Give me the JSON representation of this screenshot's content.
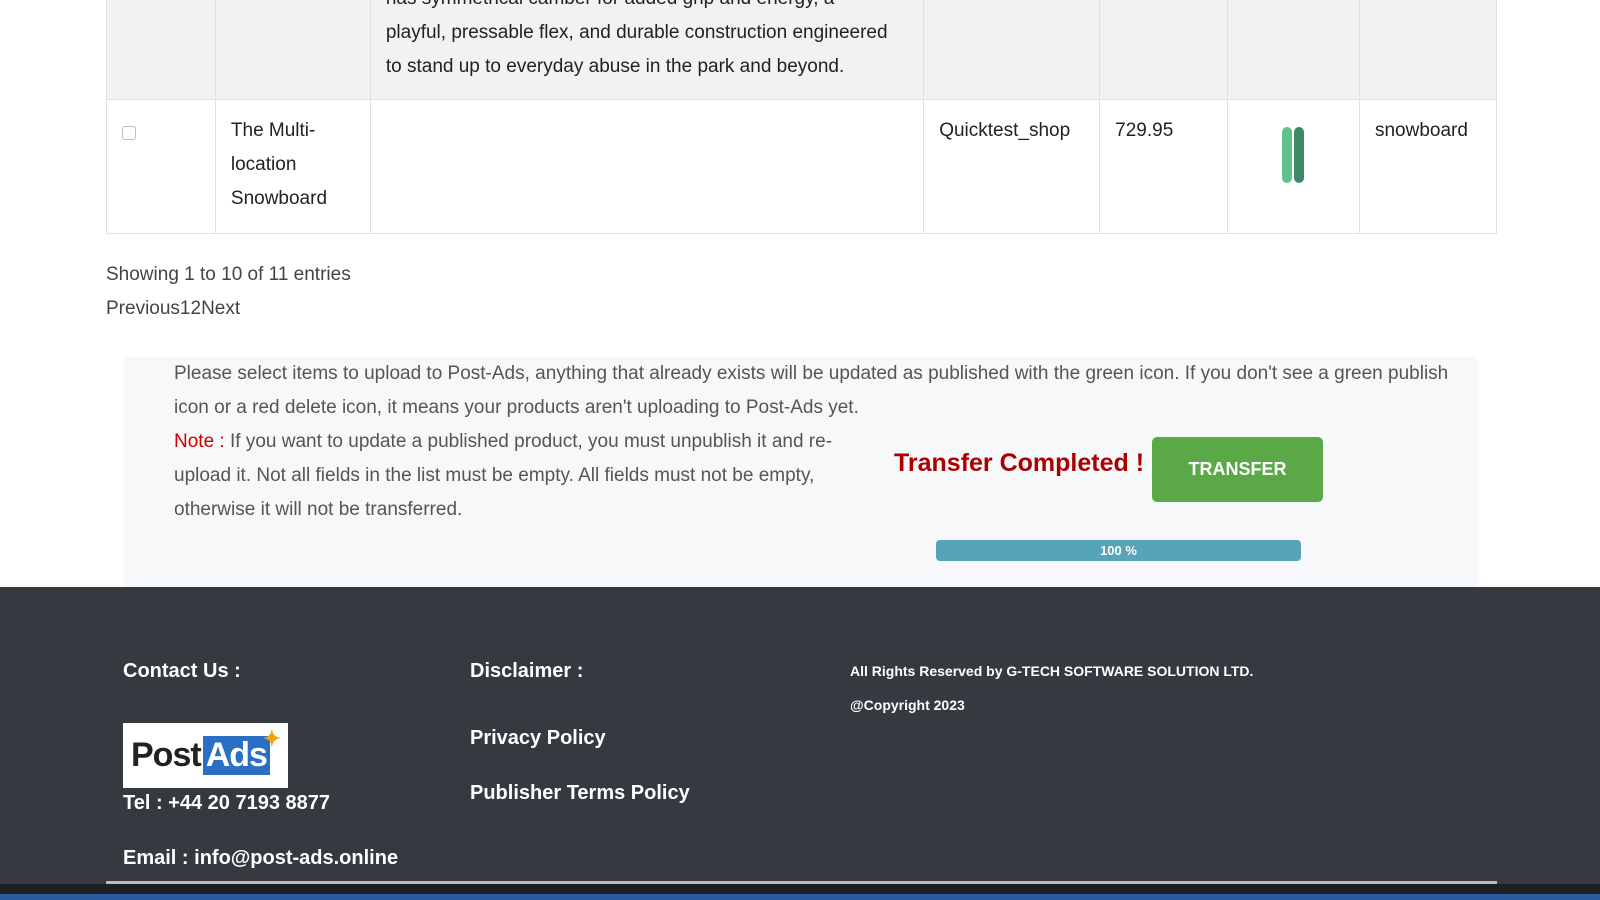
{
  "table": {
    "rows": [
      {
        "description": "has symmetrical camber for added grip and energy, a playful, pressable flex, and durable construction engineered to stand up to everyday abuse in the park and beyond.",
        "desc_lines": [
          "has symmetrical camber for added grip and energy, a",
          "playful, pressable flex, and durable construction engineered",
          "to stand up to everyday abuse in the park and beyond."
        ]
      },
      {
        "checked": false,
        "title_lines": [
          "The Multi-",
          "location",
          "Snowboard"
        ],
        "description": "",
        "shop": "Quicktest_shop",
        "price": "729.95",
        "image_icon": "snowboard-thumbnail",
        "type": "snowboard"
      }
    ]
  },
  "pagination": {
    "info": "Showing 1 to 10 of 11 entries",
    "previous": "Previous",
    "pages": [
      "1",
      "2"
    ],
    "next": "Next"
  },
  "transfer": {
    "instructions": "Please select items to upload to Post-Ads, anything that already exists will be updated as published with the green icon. If you don't see a green publish icon or a red delete icon, it means your products aren't uploading to Post-Ads yet.",
    "note_label": "Note :",
    "note_text": " If you want to update a published product, you must unpublish it and re-upload it. Not all fields in the list must be empty. All fields must not be empty, otherwise it will not be transferred.",
    "status": "Transfer Completed !",
    "button": "TRANSFER",
    "progress_percent": 100,
    "progress_label": "100 %",
    "colors": {
      "status": "#aa0000",
      "button": "#5aa846",
      "progress": "#57a3b7"
    }
  },
  "footer": {
    "contact_heading": "Contact Us :",
    "logo": {
      "text_dark": "Post",
      "text_blue": "Ads"
    },
    "tel": "Tel : +44 20 7193 8877",
    "email": "Email : info@post-ads.online",
    "disclaimer_heading": "Disclaimer :",
    "privacy": "Privacy Policy",
    "publisher_terms": "Publisher Terms Policy",
    "rights": "All Rights Reserved by G-TECH SOFTWARE SOLUTION LTD.",
    "copyright": "@Copyright 2023"
  }
}
